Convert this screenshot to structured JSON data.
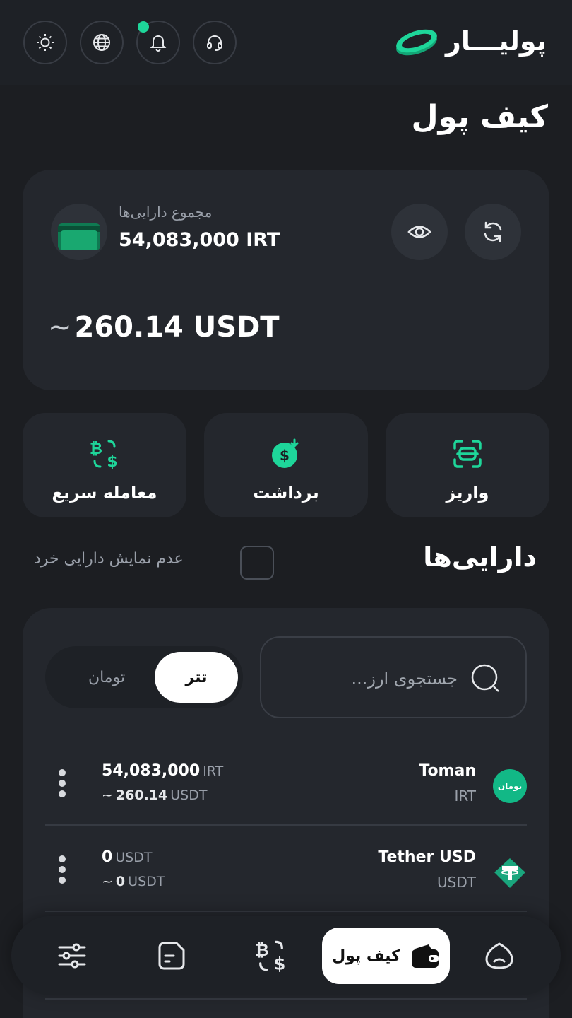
{
  "header": {
    "brand_name": "پولیـــار",
    "icons": [
      "theme-sun-icon",
      "language-globe-icon",
      "notification-bell-icon",
      "support-headset-icon"
    ],
    "accent_color": "#1ed69a"
  },
  "page": {
    "title": "کیف پول"
  },
  "balance": {
    "total_label": "مجموع دارایی‌ها",
    "total_irt": "54,083,000 IRT",
    "approx_symbol": "~",
    "total_usdt": "260.14 USDT"
  },
  "actions": [
    {
      "label": "واریز",
      "icon": "deposit-scan-icon"
    },
    {
      "label": "برداشت",
      "icon": "withdraw-dollar-icon"
    },
    {
      "label": "معامله سریع",
      "icon": "quick-trade-exchange-icon"
    }
  ],
  "assets": {
    "title": "دارایی‌ها",
    "hide_small_label": "عدم نمایش دارایی خرد",
    "hide_small_checked": false,
    "search_placeholder": "جستجوی ارز...",
    "toggle": {
      "active": "تتر",
      "inactive": "تومان"
    },
    "rows": [
      {
        "name": "Toman",
        "symbol": "IRT",
        "coin_text": "تومان",
        "amount": "54,083,000",
        "amount_unit": "IRT",
        "approx": "~",
        "converted": "260.14",
        "converted_unit": "USDT"
      },
      {
        "name": "Tether USD",
        "symbol": "USDT",
        "amount": "0",
        "amount_unit": "USDT",
        "approx": "~",
        "converted": "0",
        "converted_unit": "USDT"
      }
    ]
  },
  "bottom_nav": {
    "active_label": "کیف پول",
    "items": [
      "settings-sliders-icon",
      "orders-doc-icon",
      "exchange-icon",
      "wallet-icon",
      "home-icon"
    ]
  }
}
